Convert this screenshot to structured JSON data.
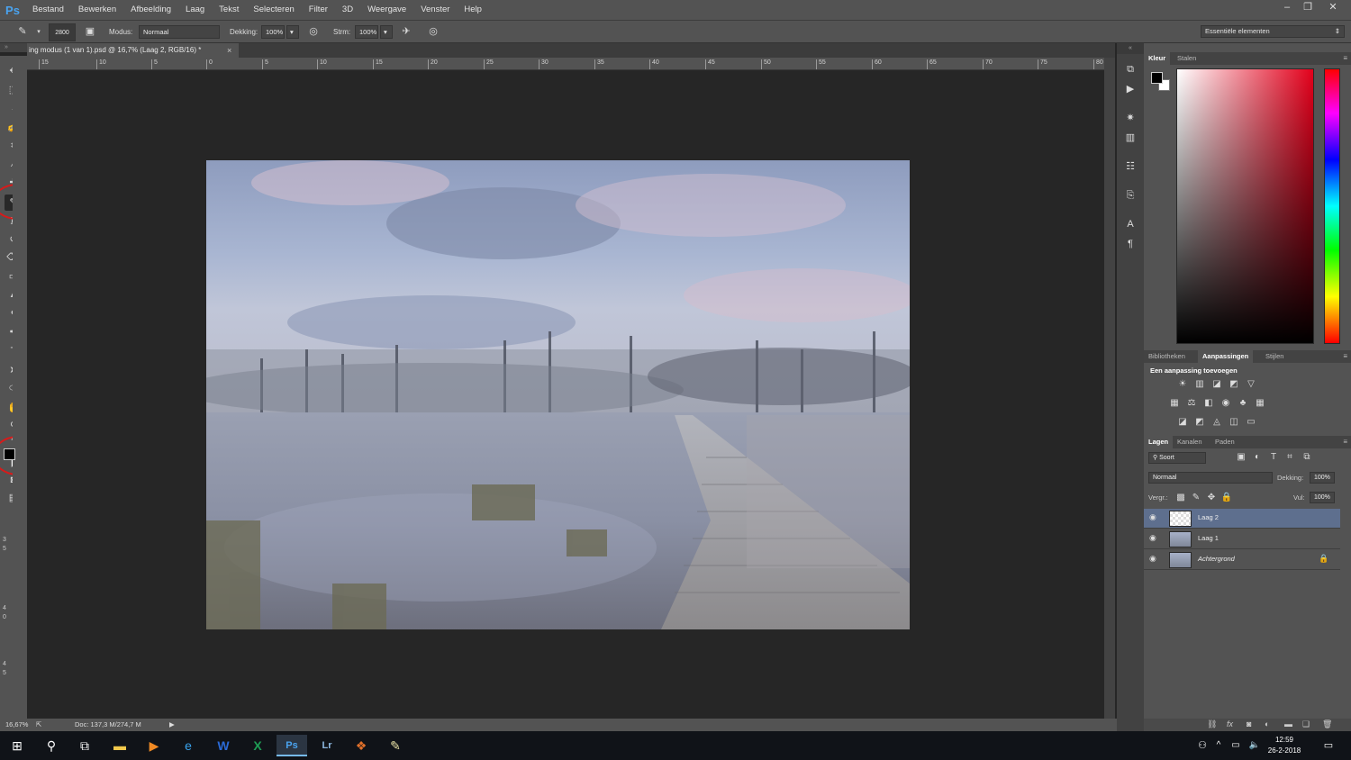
{
  "app": {
    "logo": "Ps"
  },
  "menubar": {
    "items": [
      "Bestand",
      "Bewerken",
      "Afbeelding",
      "Laag",
      "Tekst",
      "Selecteren",
      "Filter",
      "3D",
      "Weergave",
      "Venster",
      "Help"
    ],
    "window_controls": {
      "minimize": "–",
      "restore": "❐",
      "close": "✕"
    }
  },
  "options": {
    "brush_size": "2800",
    "mode_label": "Modus:",
    "mode_value": "Normaal",
    "opacity_label": "Dekking:",
    "opacity_value": "100%",
    "flow_label": "Strm:",
    "flow_value": "100%",
    "workspace": "Essentiële elementen"
  },
  "document": {
    "tab_title": "ing modus (1 van 1).psd @ 16,7% (Laag 2, RGB/16) *",
    "tab_close": "×",
    "ruler_top": [
      "15",
      "10",
      "5",
      "0",
      "5",
      "10",
      "15",
      "20",
      "25",
      "30",
      "35",
      "40",
      "45",
      "50",
      "55",
      "60",
      "65",
      "70",
      "75",
      "80"
    ],
    "ruler_left": [
      "3",
      "5",
      "4",
      "0",
      "4",
      "5"
    ]
  },
  "status": {
    "zoom": "16,67%",
    "doc": "Doc: 137,3 M/274,7 M"
  },
  "color_panel": {
    "tabs": [
      "Kleur",
      "Stalen"
    ],
    "foreground": "#000000",
    "background": "#ffffff"
  },
  "adjustments_panel": {
    "tabs": [
      "Bibliotheken",
      "Aanpassingen",
      "Stijlen"
    ],
    "title": "Een aanpassing toevoegen"
  },
  "layers_panel": {
    "tabs": [
      "Lagen",
      "Kanalen",
      "Paden"
    ],
    "filter": "Soort",
    "blend_mode": "Normaal",
    "opacity_label": "Dekking:",
    "opacity_value": "100%",
    "lock_label": "Vergr.:",
    "fill_label": "Vul:",
    "fill_value": "100%",
    "layers": [
      {
        "name": "Laag 2",
        "selected": true
      },
      {
        "name": "Laag 1",
        "selected": false
      },
      {
        "name": "Achtergrond",
        "selected": false
      }
    ]
  },
  "taskbar": {
    "time": "12:59",
    "date": "26-2-2018"
  },
  "colors": {
    "accent": "#d61b1b",
    "selection": "#5e6f8e"
  }
}
